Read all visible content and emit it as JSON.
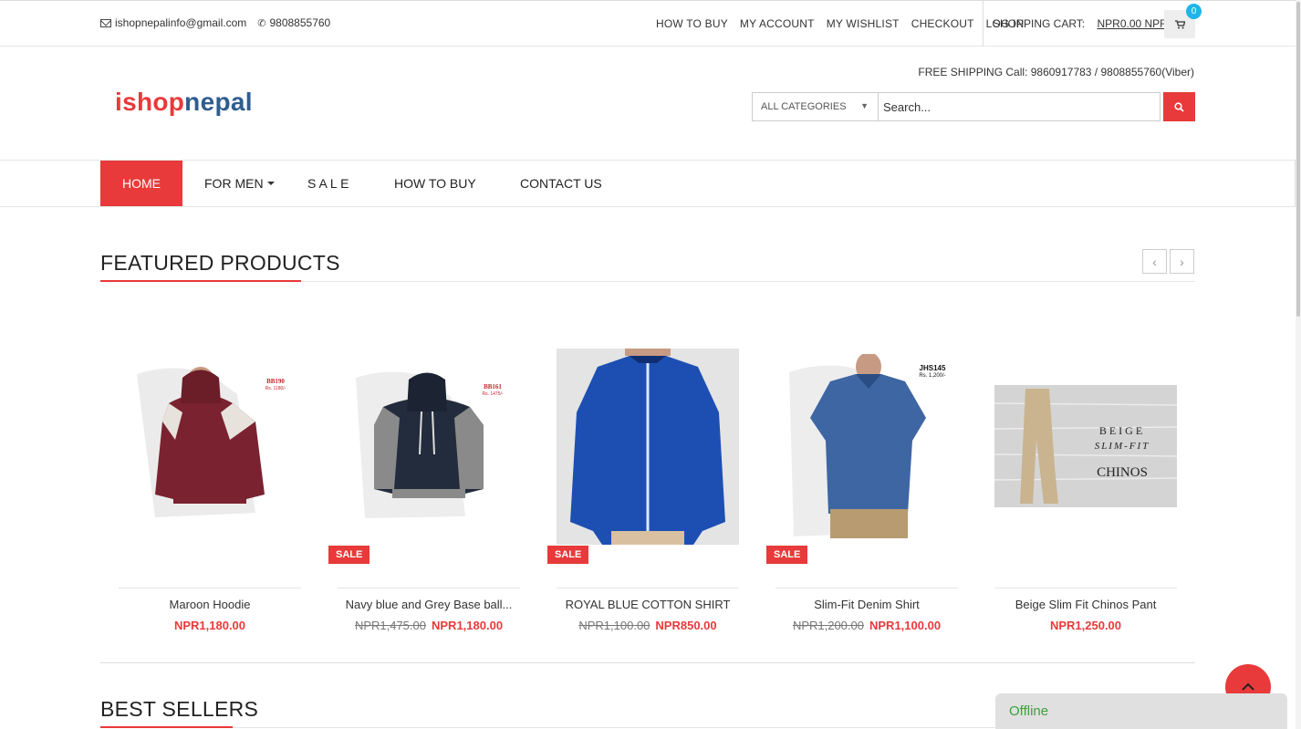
{
  "topbar": {
    "email": "ishopnepalinfo@gmail.com",
    "phone": "9808855760",
    "links": [
      "HOW TO BUY",
      "MY ACCOUNT",
      "MY WISHLIST",
      "CHECKOUT",
      "LOG IN"
    ],
    "cart_label": "SHOPPING CART:",
    "cart_amount": "NPR0.00 NPR",
    "cart_count": "0"
  },
  "header": {
    "shipping": "FREE SHIPPING Call: 9860917783 / 9808855760(Viber)",
    "logo_part1": "ishop",
    "logo_part2": "nepal",
    "category_select": "ALL CATEGORIES",
    "search_placeholder": "Search..."
  },
  "nav": {
    "items": [
      "HOME",
      "FOR MEN",
      "S A L E",
      "HOW TO BUY",
      "CONTACT US"
    ]
  },
  "featured": {
    "title": "FEATURED PRODUCTS",
    "sale_badge": "SALE",
    "products": [
      {
        "name": "Maroon Hoodie",
        "old_price": "",
        "price": "NPR1,180.00",
        "tag_code": "BB190",
        "tag_price": "Rs. 1180/-"
      },
      {
        "name": "Navy blue and Grey Base ball...",
        "old_price": "NPR1,475.00",
        "price": "NPR1,180.00",
        "tag_code": "BB161",
        "tag_price": "Rs. 1475/-"
      },
      {
        "name": "ROYAL BLUE COTTON SHIRT",
        "old_price": "NPR1,100.00",
        "price": "NPR850.00"
      },
      {
        "name": "Slim-Fit Denim Shirt",
        "old_price": "NPR1,200.00",
        "price": "NPR1,100.00",
        "tag_code": "JHS145",
        "tag_price": "Rs. 1,200/-"
      },
      {
        "name": "Beige Slim Fit Chinos Pant",
        "old_price": "",
        "price": "NPR1,250.00",
        "img_line1": "BEIGE",
        "img_line2": "SLIM-FIT",
        "img_line3": "CHINOS"
      }
    ]
  },
  "best_sellers": {
    "title": "BEST SELLERS"
  },
  "chat": {
    "status": "Offline"
  },
  "colors": {
    "accent": "#e83a3a",
    "logo_blue": "#2f5d8f",
    "badge": "#1fb5e8"
  }
}
